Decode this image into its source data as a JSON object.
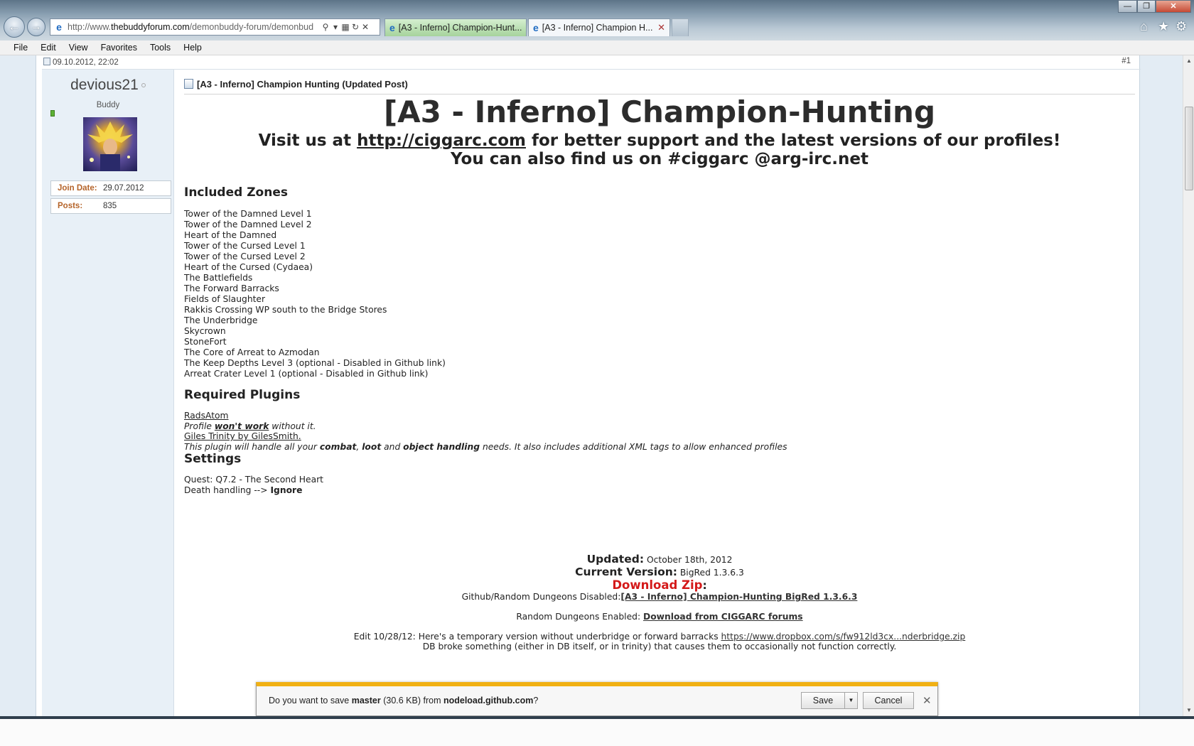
{
  "browser": {
    "url_prefix": "http://www.",
    "url_domain": "thebuddyforum.com",
    "url_rest": "/demonbuddy-forum/demonbud",
    "tabs": [
      {
        "label": "[A3 - Inferno] Champion-Hunt..."
      },
      {
        "label": "[A3 - Inferno] Champion H..."
      }
    ]
  },
  "menu": [
    "File",
    "Edit",
    "View",
    "Favorites",
    "Tools",
    "Help"
  ],
  "post": {
    "date": "09.10.2012, 22:02",
    "number": "#1",
    "title": "[A3 - Inferno] Champion Hunting (Updated Post)"
  },
  "user": {
    "name": "devious21",
    "title": "Buddy",
    "join_label": "Join Date:",
    "join_value": "29.07.2012",
    "posts_label": "Posts:",
    "posts_value": "835"
  },
  "body": {
    "heading": "[A3 - Inferno] Champion-Hunting",
    "visit_pre": "Visit us at ",
    "visit_link": "http://ciggarc.com",
    "visit_post": " for better support and the latest versions of our profiles!",
    "irc": "You can also find us on #ciggarc @arg-irc.net",
    "zones_heading": "Included Zones",
    "zones": [
      "Tower of the Damned Level 1",
      "Tower of the Damned Level 2",
      "Heart of the Damned",
      "Tower of the Cursed Level 1",
      "Tower of the Cursed Level 2",
      "Heart of the Cursed (Cydaea)",
      "The Battlefields",
      "The Forward Barracks",
      "Fields of Slaughter",
      "Rakkis Crossing WP south to the Bridge Stores",
      "The Underbridge",
      "Skycrown",
      "StoneFort",
      "The Core of Arreat to Azmodan",
      "The Keep Depths Level 3 (optional - Disabled in Github link)",
      "Arreat Crater Level 1 (optional - Disabled in Github link)"
    ],
    "plugins_heading": "Required Plugins",
    "plugin1_link": "RadsAtom",
    "plugin1_pre": "Profile ",
    "plugin1_bold": "won't work",
    "plugin1_post": " without it.",
    "plugin2_link": "Giles Trinity by GilesSmith.",
    "plugin2_t1": "This plugin will handle all your ",
    "plugin2_b1": "combat",
    "plugin2_t2": ", ",
    "plugin2_b2": "loot",
    "plugin2_t3": " and ",
    "plugin2_b3": "object handling",
    "plugin2_t4": " needs. It also includes additional XML tags to allow enhanced profiles",
    "settings_heading": "Settings",
    "quest": "Quest: Q7.2 - The Second Heart",
    "death_pre": "Death handling --> ",
    "death_val": "Ignore",
    "updated_label": "Updated:",
    "updated_value": "October 18th, 2012",
    "version_label": "Current Version:",
    "version_value": "BigRed 1.3.6.3",
    "zip_label": "Download Zip",
    "zip_colon": ":",
    "github_label": "Github/Random Dungeons Disabled:",
    "github_link": "[A3 - Inferno] Champion-Hunting BigRed 1.3.6.3",
    "random_label": "Random Dungeons Enabled: ",
    "random_link": "Download from CIGGARC forums",
    "edit_text": "Edit 10/28/12: Here's a temporary version without underbridge or forward barracks ",
    "edit_link": "https://www.dropbox.com/s/fw912ld3cx...nderbridge.zip",
    "db_note": "DB broke something (either in DB itself, or in trinity) that causes them to occasionally not function correctly."
  },
  "download": {
    "msg_pre": "Do you want to save ",
    "file": "master",
    "size": " (30.6 KB) from ",
    "host": "nodeload.github.com",
    "msg_post": "?",
    "save": "Save",
    "cancel": "Cancel"
  }
}
